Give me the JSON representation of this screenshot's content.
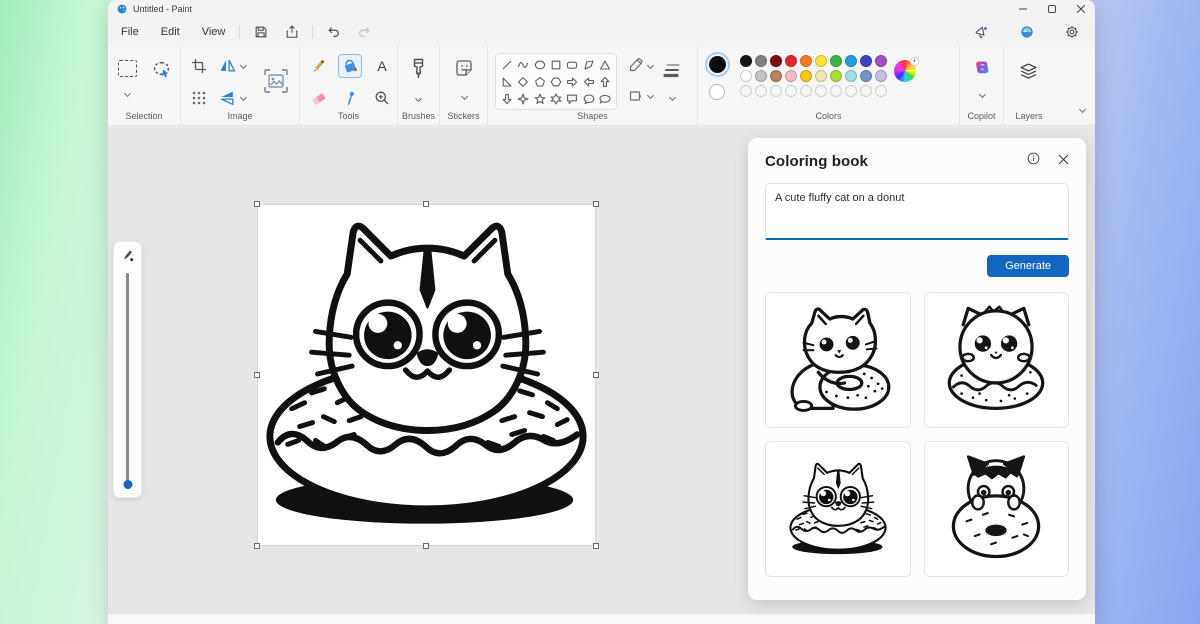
{
  "window": {
    "title": "Untitled - Paint",
    "caption": {
      "minimize": "minimize",
      "maximize": "maximize",
      "close": "close"
    },
    "menu": {
      "file": "File",
      "edit": "Edit",
      "view": "View"
    },
    "ribbon": {
      "groups": {
        "selection": "Selection",
        "image": "Image",
        "tools": "Tools",
        "brushes": "Brushes",
        "stickers": "Stickers",
        "shapes": "Shapes",
        "colors": "Colors",
        "copilot": "Copilot",
        "layers": "Layers"
      },
      "text_tool_label": "A",
      "shapes_list": [
        "line",
        "curve",
        "oval",
        "square",
        "rounded-rectangle",
        "polygon",
        "triangle",
        "right-triangle",
        "diamond",
        "pentagon",
        "hexagon",
        "arrow-right",
        "arrow-left",
        "arrow-up",
        "arrow-down",
        "four-point-star",
        "five-point-star",
        "six-point-star",
        "rect-bubble",
        "round-bubble",
        "oval-bubble",
        "arc",
        "arc"
      ],
      "palette": {
        "color1": "#0d0d0d",
        "color2": "#ffffff",
        "row1": [
          "#151515",
          "#7f7f7f",
          "#7c101a",
          "#e4282d",
          "#f07c22",
          "#fbe33a",
          "#3cb24d",
          "#229bdf",
          "#3e43c2",
          "#9b4fc0"
        ],
        "row2": [
          "#ffffff",
          "#c4c4c4",
          "#b9815e",
          "#f4bac6",
          "#fbc515",
          "#efe6ae",
          "#aade39",
          "#a3dced",
          "#7494c1",
          "#c6bee6"
        ],
        "empty_count": 10
      }
    }
  },
  "panel": {
    "title": "Coloring book",
    "prompt": "A cute fluffy cat on a donut",
    "generate": "Generate",
    "thumbnails": [
      "cat hugging a donut",
      "fluffy cat on a donut",
      "striped cat in a donut",
      "tuxedo cat behind a donut"
    ]
  }
}
